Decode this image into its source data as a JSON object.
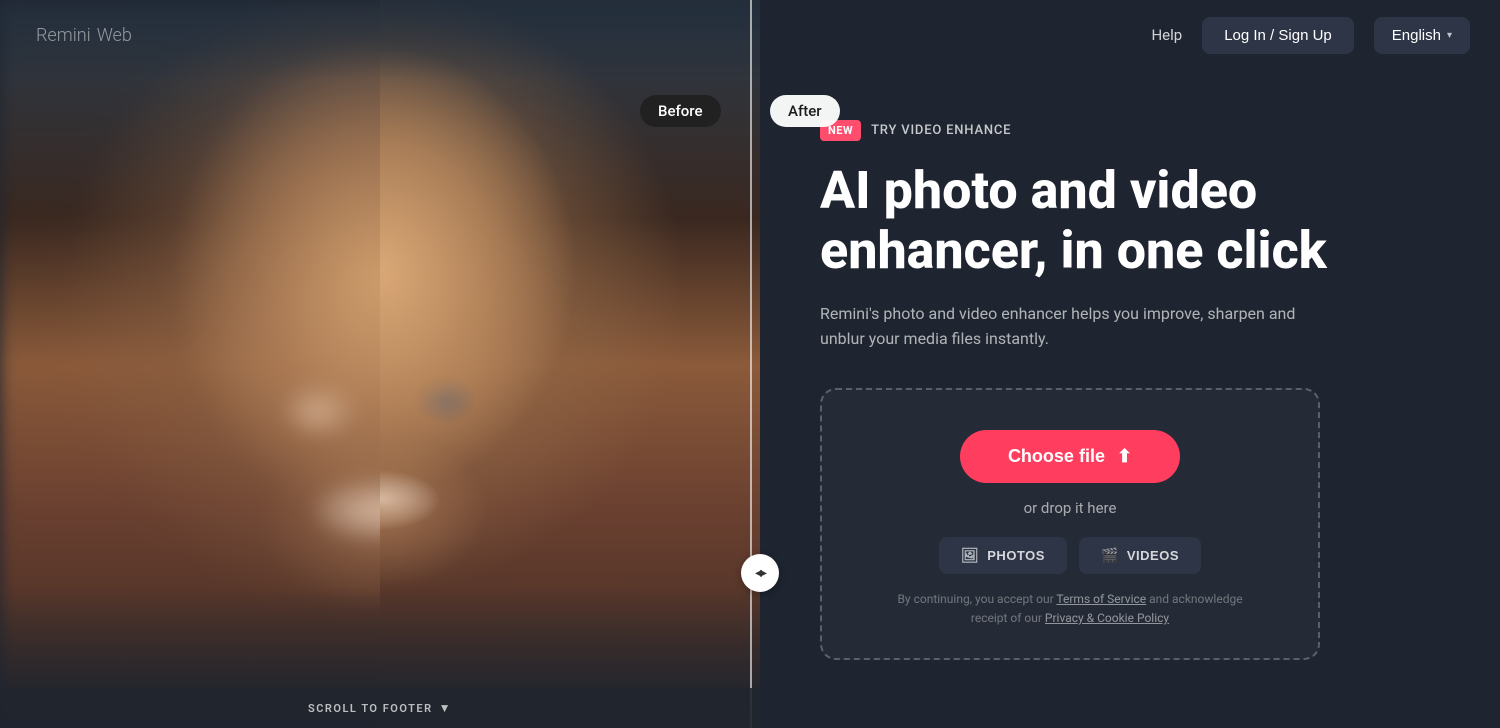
{
  "brand": {
    "name": "Remini",
    "suffix": "Web"
  },
  "nav": {
    "help_label": "Help",
    "login_label": "Log In / Sign Up",
    "language_label": "English"
  },
  "photo_labels": {
    "before": "Before",
    "after": "After"
  },
  "scroll_footer": {
    "text": "SCROLL TO FOOTER"
  },
  "content": {
    "new_badge": "NEW",
    "try_video": "TRY VIDEO ENHANCE",
    "heading_line1": "AI photo and video",
    "heading_line2": "enhancer, in one click",
    "subtitle": "Remini's photo and video enhancer helps you improve, sharpen and unblur your media files instantly.",
    "choose_file": "Choose file",
    "or_drop": "or drop it here",
    "photos_label": "PHOTOS",
    "videos_label": "VIDEOS",
    "terms_text": "By continuing, you accept our Terms of Service and acknowledge receipt of our Privacy & Cookie Policy",
    "terms_link1": "Terms of Service",
    "terms_link2": "Privacy & Cookie Policy"
  },
  "divider": {
    "handle_arrows": "◂▸"
  }
}
